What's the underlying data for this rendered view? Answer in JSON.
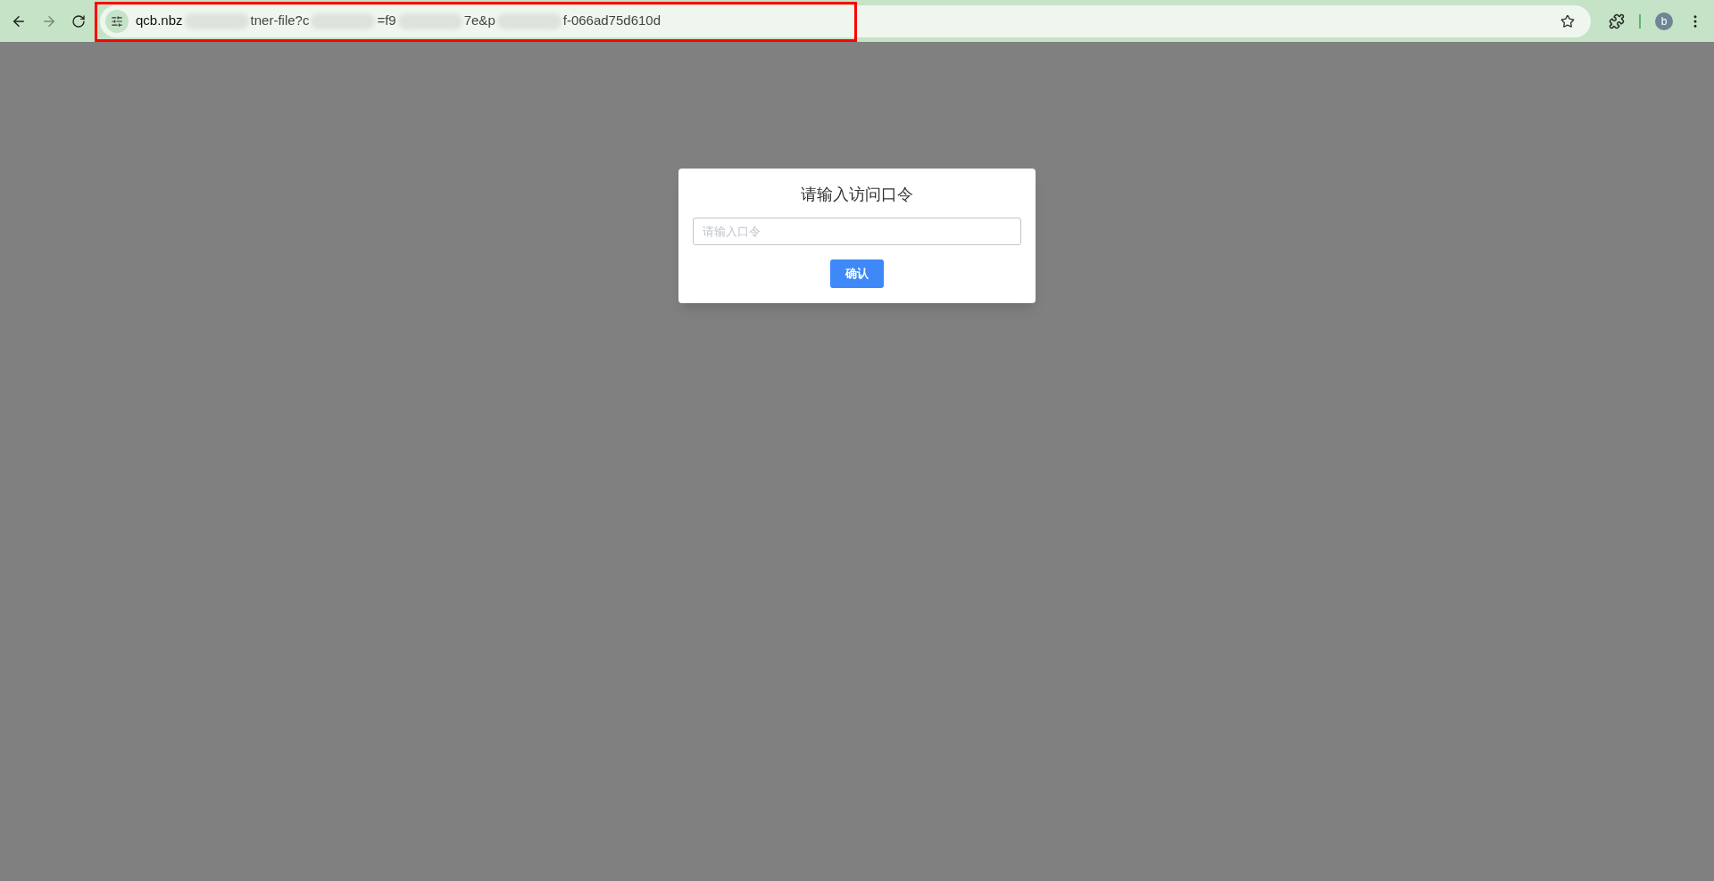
{
  "browser": {
    "address_segments": [
      "qcb.nbz",
      "tner-file?c",
      "=f9",
      "7e&p",
      "f-066ad75d610d"
    ],
    "highlighted": true,
    "profile_initial": "b"
  },
  "dialog": {
    "title": "请输入访问口令",
    "input": {
      "placeholder": "请输入口令"
    },
    "button": "确认"
  }
}
